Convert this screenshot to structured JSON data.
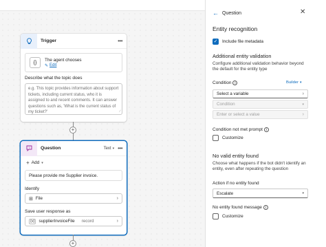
{
  "canvas": {
    "trigger": {
      "title": "Trigger",
      "card_title": "The agent chooses",
      "card_edit": "Edit",
      "desc_label": "Describe what the topic does",
      "desc_placeholder": "e.g. This topic provides information about support tickets, including current status, who it is assigned to and recent comments. It can answer questions such as, 'What is the current status of my ticket?'"
    },
    "question": {
      "title": "Question",
      "type_label": "Text",
      "add_label": "Add",
      "message": "Please provide me Supplier invoice.",
      "identify_label": "Identify",
      "identify_value": "File",
      "save_label": "Save user response as",
      "variable_name": "supplierInvoiceFile",
      "variable_type": "record"
    }
  },
  "panel": {
    "back_label": "Question",
    "title": "Entity recognition",
    "include_metadata_label": "Include file metadata",
    "include_metadata_checked": true,
    "validation_title": "Additional entity validation",
    "validation_desc": "Configure additional validation behavior beyond the default for the entity type",
    "condition_label": "Condition",
    "builder_label": "Builder",
    "select_variable": "Select a variable",
    "condition_placeholder": "Condition",
    "value_placeholder": "Enter or select a value",
    "not_met_label": "Condition not met prompt",
    "not_met_customize": "Customize",
    "no_valid_title": "No valid entity found",
    "no_valid_desc": "Choose what happens if the bot didn't identify an entity, even after repeating the question",
    "action_label": "Action if no entity found",
    "action_value": "Escalate",
    "no_entity_msg_label": "No entity found message",
    "no_entity_customize": "Customize"
  },
  "colors": {
    "accent": "#0f6cbd",
    "trigger_icon_bg": "#e8f0fb",
    "question_icon_bg": "#f3e8f7",
    "question_border": "#0f6cbd"
  }
}
